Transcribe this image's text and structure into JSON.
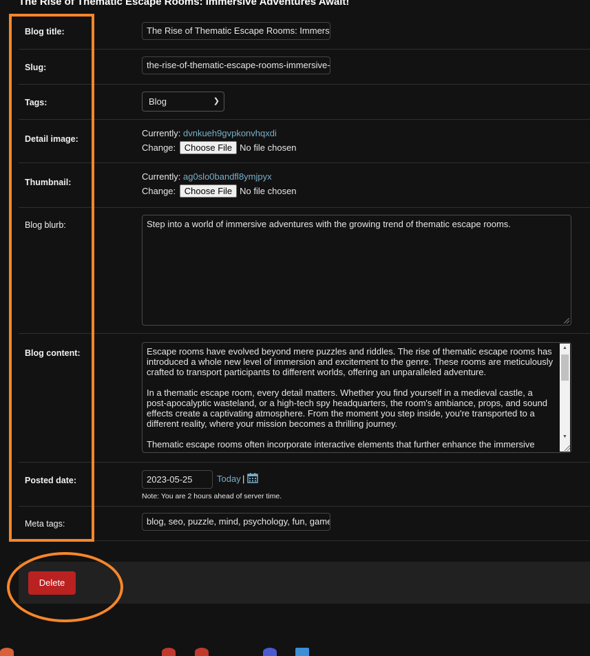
{
  "page": {
    "title": "The Rise of Thematic Escape Rooms: Immersive Adventures Await!"
  },
  "fields": {
    "blog_title": {
      "label": "Blog title:",
      "value": "The Rise of Thematic Escape Rooms: Immersive Adventures Await!"
    },
    "slug": {
      "label": "Slug:",
      "value": "the-rise-of-thematic-escape-rooms-immersive-adventures-await"
    },
    "tags": {
      "label": "Tags:",
      "selected": "Blog"
    },
    "detail_image": {
      "label": "Detail image:",
      "currently_label": "Currently:",
      "currently_value": "dvnkueh9gvpkonvhqxdi",
      "change_label": "Change:",
      "choose_button": "Choose File",
      "file_status": "No file chosen"
    },
    "thumbnail": {
      "label": "Thumbnail:",
      "currently_label": "Currently:",
      "currently_value": "ag0slo0bandfl8ymjpyx",
      "change_label": "Change:",
      "choose_button": "Choose File",
      "file_status": "No file chosen"
    },
    "blog_blurb": {
      "label": "Blog blurb:",
      "value": "Step into a world of immersive adventures with the growing trend of thematic escape rooms."
    },
    "blog_content": {
      "label": "Blog content:",
      "paragraphs": [
        "Escape rooms have evolved beyond mere puzzles and riddles. The rise of thematic escape rooms has introduced a whole new level of immersion and excitement to the genre. These rooms are meticulously crafted to transport participants to different worlds, offering an unparalleled adventure.",
        "In a thematic escape room, every detail matters. Whether you find yourself in a medieval castle, a post-apocalyptic wasteland, or a high-tech spy headquarters, the room's ambiance, props, and sound effects create a captivating atmosphere. From the moment you step inside, you're transported to a different reality, where your mission becomes a thrilling journey.",
        "Thematic escape rooms often incorporate interactive elements that further enhance the immersive"
      ]
    },
    "posted_date": {
      "label": "Posted date:",
      "value": "2023-05-25",
      "today_link": "Today",
      "separator": "|",
      "help_text": "Note: You are 2 hours ahead of server time."
    },
    "meta_tags": {
      "label": "Meta tags:",
      "value": "blog, seo, puzzle, mind, psychology, fun, games"
    }
  },
  "actions": {
    "delete_label": "Delete"
  },
  "colors": {
    "background": "#121212",
    "link": "#79aec8",
    "delete": "#ba2121",
    "annotation": "#f7862a"
  }
}
